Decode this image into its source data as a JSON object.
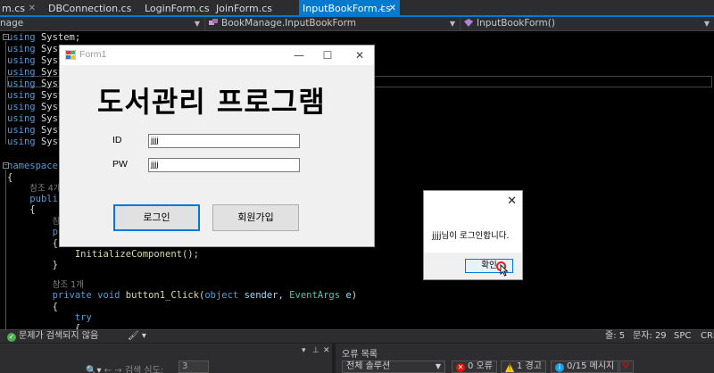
{
  "tabs": [
    {
      "label": "m.cs",
      "active": false
    },
    {
      "label": "DBConnection.cs",
      "active": false
    },
    {
      "label": "LoginForm.cs",
      "active": false
    },
    {
      "label": "JoinForm.cs",
      "active": false
    },
    {
      "label": "InputBookForm.cs",
      "active": true
    }
  ],
  "navbar": {
    "project": "nage",
    "class": "BookManage.InputBookForm",
    "member": "InputBookForm()"
  },
  "code": {
    "using_kw": "using",
    "using_ns": "Syste",
    "using_first": "System;",
    "namespace_kw": "namespace",
    "namespace_name": "B",
    "ref4": "참조 4개",
    "public_kw": "public",
    "ref_partial": "참조",
    "pub_partial": "pub",
    "init_call": "InitializeComponent();",
    "ref1": "참조 1개",
    "method_sig_private": "private",
    "method_sig_void": "void",
    "method_name": "button1_Click",
    "method_params_type": "object",
    "method_params_sender": "sender,",
    "method_params_type2": "EventArgs",
    "method_params_e": "e",
    "try_kw": "try"
  },
  "form1": {
    "title": "Form1",
    "heading": "도서관리 프로그램",
    "id_label": "ID",
    "pw_label": "PW",
    "id_value": "jjjj",
    "pw_value": "jjjj",
    "login_button": "로그인",
    "signup_button": "회원가입",
    "minimize_glyph": "—",
    "maximize_glyph": "☐",
    "close_glyph": "✕"
  },
  "msgbox": {
    "close_glyph": "✕",
    "message": "jjjj님이 로그인합니다.",
    "ok_button": "확인"
  },
  "statusbar": {
    "status_text": "문제가 검색되지 않음",
    "line": "줄: 5",
    "char": "문자: 29",
    "mode": "SPC",
    "eol": "CRL"
  },
  "bottom_panel": {
    "search_label": "검색 심도:",
    "search_depth": "3",
    "errors_title": "오류 목록",
    "scope": "전체 솔루션",
    "errors": "0 오류",
    "warnings": "1 경고",
    "messages": "0/15 메시지"
  },
  "colors": {
    "accent": "#007acc",
    "error": "#e51400",
    "warning": "#ffcc00",
    "info": "#1ba1e2"
  }
}
